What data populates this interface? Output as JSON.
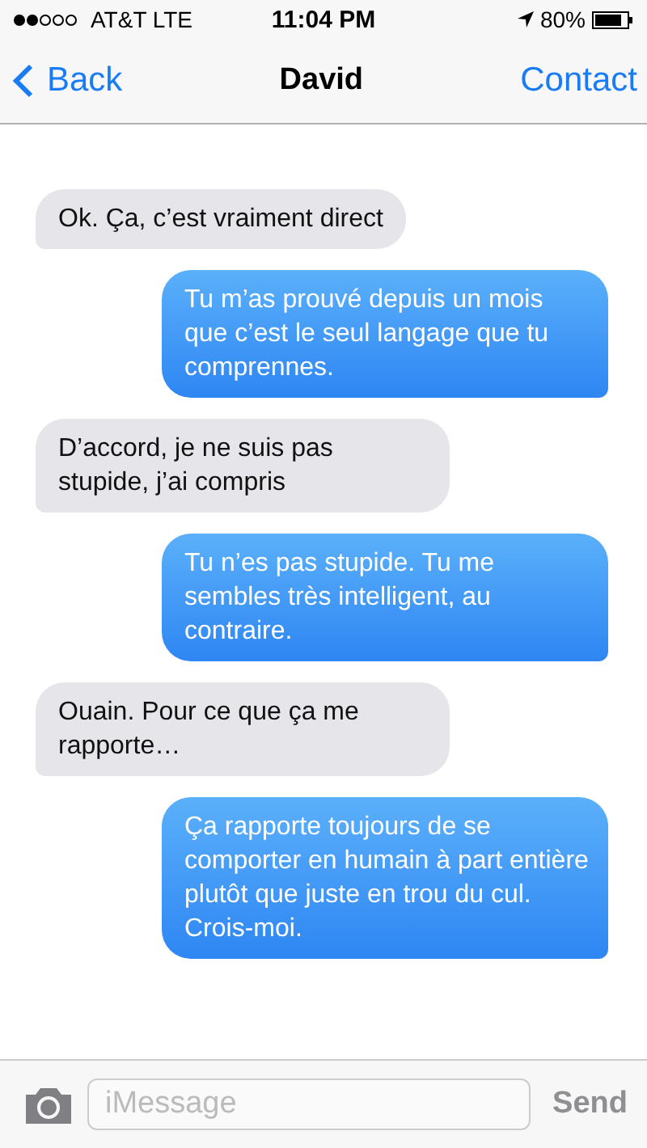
{
  "status_bar": {
    "carrier": "AT&T LTE",
    "time": "11:04 PM",
    "battery": "80%"
  },
  "nav": {
    "back": "Back",
    "title": "David",
    "action": "Contact"
  },
  "messages": [
    {
      "kind": "received",
      "text": "Ok. Ça, c’est vraiment direct"
    },
    {
      "kind": "sent",
      "text": "Tu m’as prouvé depuis un mois que c’est le seul langage que tu comprennes."
    },
    {
      "kind": "received",
      "text": "D’accord, je ne suis pas stupide, j’ai compris"
    },
    {
      "kind": "sent",
      "text": "Tu n’es pas stupide. Tu me sembles très intelligent, au contraire."
    },
    {
      "kind": "received",
      "text": "Ouain. Pour ce que ça me rapporte…"
    },
    {
      "kind": "sent",
      "text": "Ça rapporte toujours de se comporter en humain à part entière plutôt que juste en trou du cul. Crois-moi."
    }
  ],
  "composer": {
    "placeholder": "iMessage",
    "send": "Send",
    "send_disabled": true
  }
}
